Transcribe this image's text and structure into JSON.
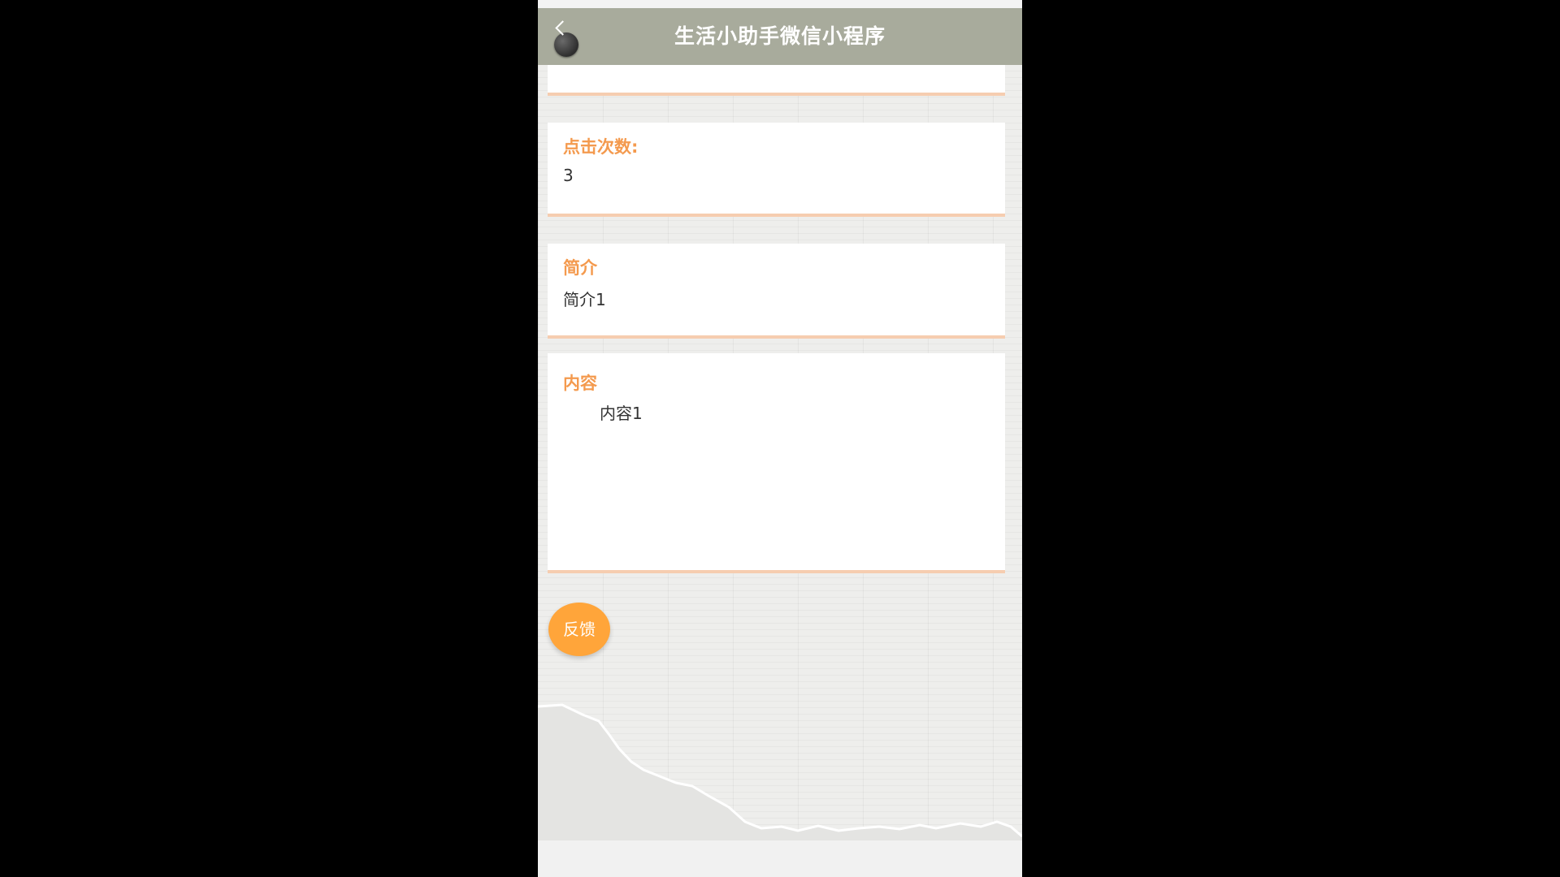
{
  "navbar": {
    "title": "生活小助手微信小程序",
    "back_icon": "back-chevron-icon"
  },
  "details": {
    "clicks_label": "点击次数:",
    "clicks_value": "3",
    "intro_label": "简介",
    "intro_value": "简介1",
    "content_label": "内容",
    "content_value": "内容1"
  },
  "feedback": {
    "label": "反馈"
  },
  "colors": {
    "navbar": "#a8ab9c",
    "label": "#f49a4e",
    "card_border": "#f6cdb0",
    "feedback_button": "#ffa53a"
  }
}
